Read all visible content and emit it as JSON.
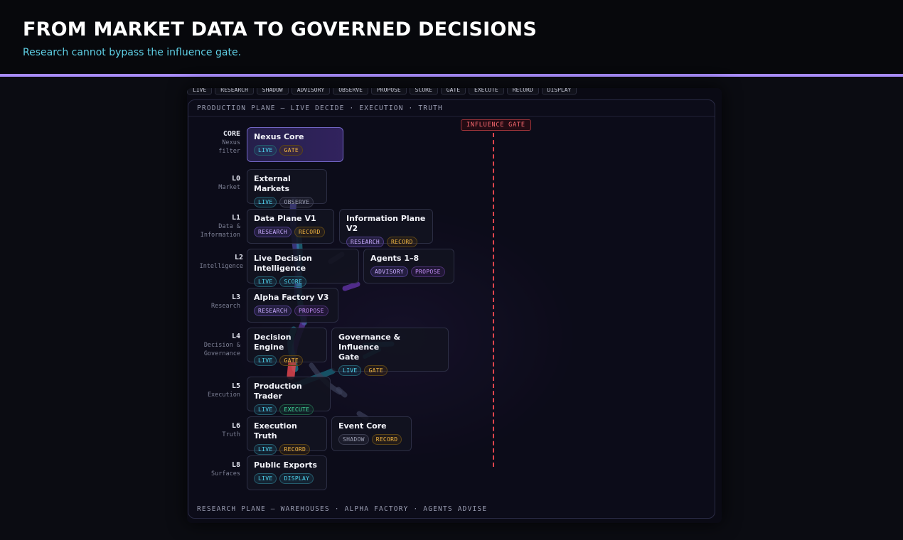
{
  "header": {
    "title": "FROM MARKET DATA TO GOVERNED DECISIONS",
    "subtitle": "Research cannot bypass the influence gate."
  },
  "colors": {
    "accent_bar": "#a78bfa",
    "subtitle": "#5fd0e6",
    "gate": "#e0454d",
    "live": "#4fd4ef",
    "gate_badge": "#f3b640"
  },
  "filters": [
    "LIVE",
    "RESEARCH",
    "SHADOW",
    "ADVISORY",
    "OBSERVE",
    "PROPOSE",
    "SCORE",
    "GATE",
    "EXECUTE",
    "RECORD",
    "DISPLAY"
  ],
  "diagram": {
    "production_plane": "PRODUCTION PLANE — LIVE DECIDE · EXECUTION · TRUTH",
    "research_plane": "RESEARCH PLANE — WAREHOUSES · ALPHA FACTORY · AGENTS ADVISE",
    "influence_gate": "INFLUENCE GATE",
    "levels": [
      {
        "code": "CORE",
        "desc1": "Nexus",
        "desc2": "filter"
      },
      {
        "code": "L0",
        "desc1": "Market",
        "desc2": ""
      },
      {
        "code": "L1",
        "desc1": "Data &",
        "desc2": "Information"
      },
      {
        "code": "L2",
        "desc1": "Intelligence",
        "desc2": ""
      },
      {
        "code": "L3",
        "desc1": "Research",
        "desc2": ""
      },
      {
        "code": "L4",
        "desc1": "Decision &",
        "desc2": "Governance"
      },
      {
        "code": "L5",
        "desc1": "Execution",
        "desc2": ""
      },
      {
        "code": "L6",
        "desc1": "Truth",
        "desc2": ""
      },
      {
        "code": "L8",
        "desc1": "Surfaces",
        "desc2": ""
      }
    ],
    "nodes": {
      "nexus_core": {
        "title": "Nexus Core",
        "badges": [
          "LIVE",
          "GATE"
        ]
      },
      "external_markets": {
        "title": "External Markets",
        "badges": [
          "LIVE",
          "OBSERVE"
        ]
      },
      "data_plane": {
        "title": "Data Plane V1",
        "badges": [
          "RESEARCH",
          "RECORD"
        ]
      },
      "information_plane": {
        "title": "Information Plane V2",
        "badges": [
          "RESEARCH",
          "RECORD"
        ]
      },
      "live_decision": {
        "title": "Live Decision Intelligence",
        "badges": [
          "LIVE",
          "SCORE"
        ]
      },
      "agents": {
        "title": "Agents 1–8",
        "badges": [
          "ADVISORY",
          "PROPOSE"
        ]
      },
      "alpha_factory": {
        "title": "Alpha Factory V3",
        "badges": [
          "RESEARCH",
          "PROPOSE"
        ]
      },
      "decision_engine": {
        "title": "Decision Engine",
        "badges": [
          "LIVE",
          "GATE"
        ]
      },
      "governance": {
        "title1": "Governance & Influence",
        "title2": "Gate",
        "badges": [
          "LIVE",
          "GATE"
        ]
      },
      "production_trader": {
        "title": "Production Trader",
        "badges": [
          "LIVE",
          "EXECUTE"
        ]
      },
      "execution_truth": {
        "title": "Execution Truth",
        "badges": [
          "LIVE",
          "RECORD"
        ]
      },
      "event_core": {
        "title": "Event Core",
        "badges": [
          "SHADOW",
          "RECORD"
        ]
      },
      "public_exports": {
        "title": "Public Exports",
        "badges": [
          "LIVE",
          "DISPLAY"
        ]
      }
    }
  }
}
